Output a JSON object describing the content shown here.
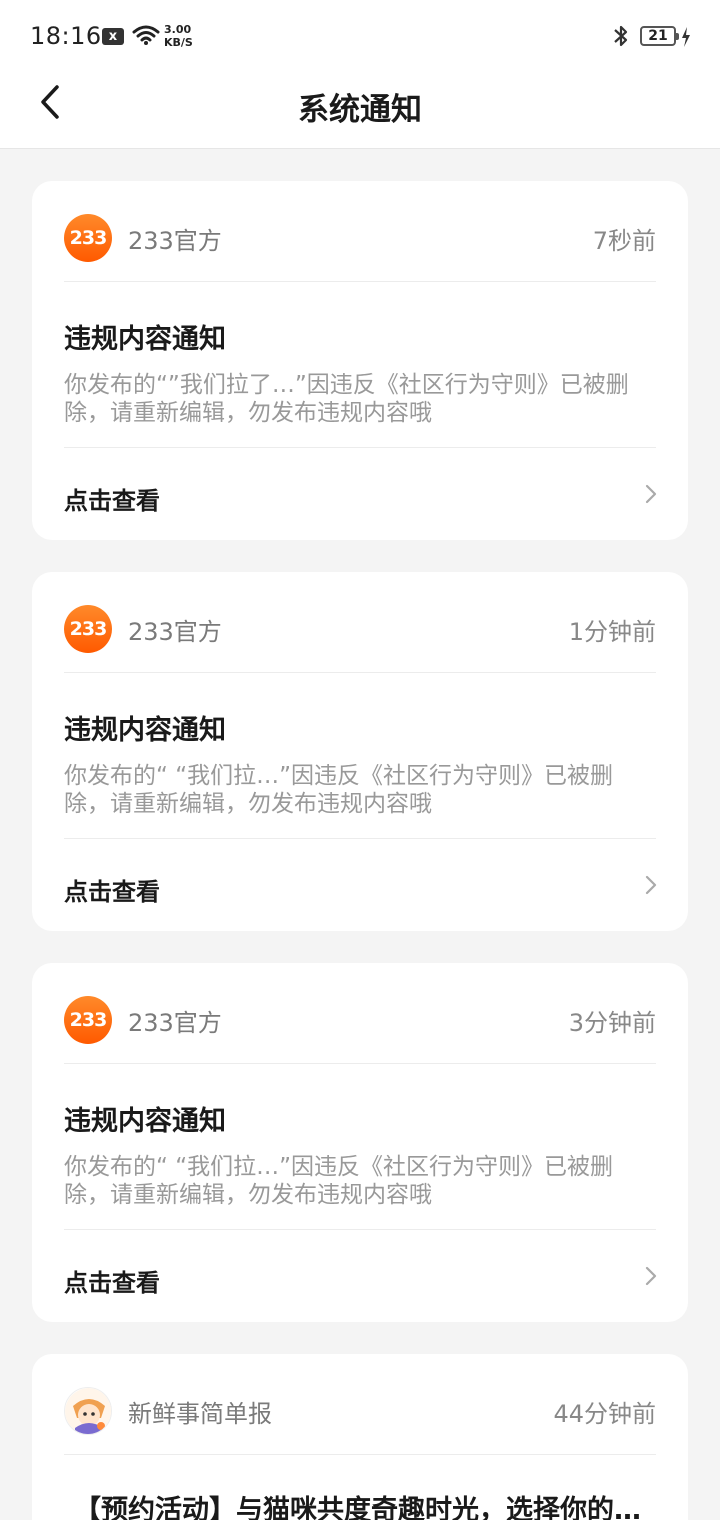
{
  "status_bar": {
    "time": "18:16",
    "x_badge": "x",
    "speed_value": "3.00",
    "speed_unit": "KB/S",
    "battery": "21"
  },
  "header": {
    "title": "系统通知",
    "back_icon": "chevron-left-icon"
  },
  "colors": {
    "avatar_orange": "#ff6a10",
    "page_bg": "#f4f4f4"
  },
  "notifications": [
    {
      "sender": "233官方",
      "avatar_text": "233",
      "time": "7秒前",
      "title": "违规内容通知",
      "body": "你发布的“”我们拉了…”因违反《社区行为守则》已被删除，请重新编辑，勿发布违规内容哦",
      "action": "点击查看"
    },
    {
      "sender": "233官方",
      "avatar_text": "233",
      "time": "1分钟前",
      "title": "违规内容通知",
      "body": "你发布的“ “我们拉…”因违反《社区行为守则》已被删除，请重新编辑，勿发布违规内容哦",
      "action": "点击查看"
    },
    {
      "sender": "233官方",
      "avatar_text": "233",
      "time": "3分钟前",
      "title": "违规内容通知",
      "body": "你发布的“ “我们拉…”因违反《社区行为守则》已被删除，请重新编辑，勿发布违规内容哦",
      "action": "点击查看"
    },
    {
      "sender": "新鲜事简单报",
      "time": "44分钟前",
      "title": "【预约活动】与猫咪共度奇趣时光，选择你的…"
    }
  ]
}
